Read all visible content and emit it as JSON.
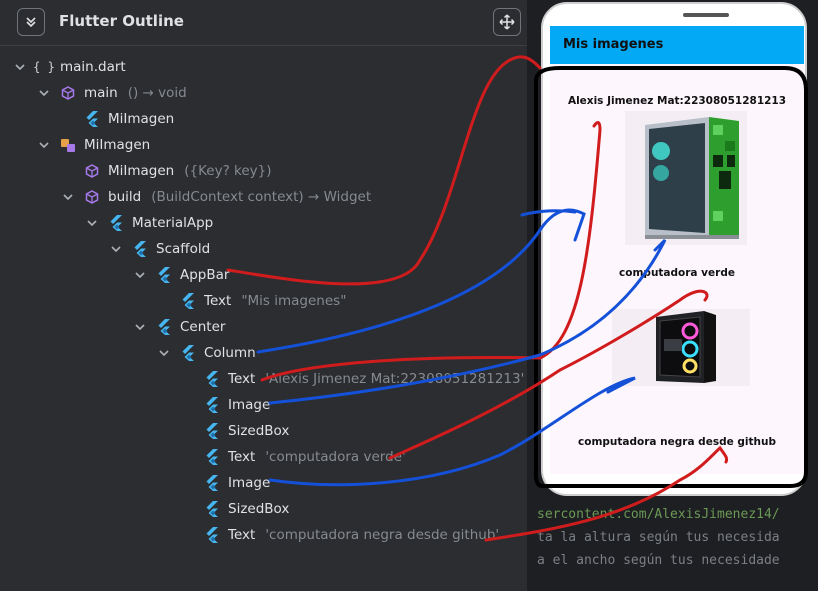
{
  "panel": {
    "title": "Flutter Outline"
  },
  "tree": [
    {
      "label": "main.dart",
      "sub": ""
    },
    {
      "label": "main",
      "sub": "() → void"
    },
    {
      "label": "MiImagen",
      "sub": ""
    },
    {
      "label": "MiImagen",
      "sub": ""
    },
    {
      "label": "MiImagen",
      "sub": "({Key? key})"
    },
    {
      "label": "build",
      "sub": "(BuildContext context) → Widget"
    },
    {
      "label": "MaterialApp",
      "sub": ""
    },
    {
      "label": "Scaffold",
      "sub": ""
    },
    {
      "label": "AppBar",
      "sub": ""
    },
    {
      "label": "Text",
      "sub": "\"Mis imagenes\""
    },
    {
      "label": "Center",
      "sub": ""
    },
    {
      "label": "Column",
      "sub": ""
    },
    {
      "label": "Text",
      "sub": "'Alexis Jimenez Mat:22308051281213'"
    },
    {
      "label": "Image",
      "sub": ""
    },
    {
      "label": "SizedBox",
      "sub": ""
    },
    {
      "label": "Text",
      "sub": "'computadora verde'"
    },
    {
      "label": "Image",
      "sub": ""
    },
    {
      "label": "SizedBox",
      "sub": ""
    },
    {
      "label": "Text",
      "sub": "'computadora negra desde github'"
    }
  ],
  "code": {
    "url_line": "sercontent.com/AlexisJimenez14/",
    "line2": "ta la altura según tus necesida",
    "line3": "a el ancho según tus necesidade"
  },
  "phone": {
    "appbar_title": "Mis imagenes",
    "header_text": "Alexis Jimenez Mat:22308051281213",
    "caption_green": "computadora verde",
    "caption_black": "computadora negra desde github"
  },
  "colors": {
    "panel_bg": "#2b2d30",
    "appbar": "#03a9f4",
    "arrow_red": "#d01c1c",
    "arrow_blue": "#1450d8",
    "flutter_icon": "#47b5f0",
    "class_icon": "#a679e8"
  }
}
